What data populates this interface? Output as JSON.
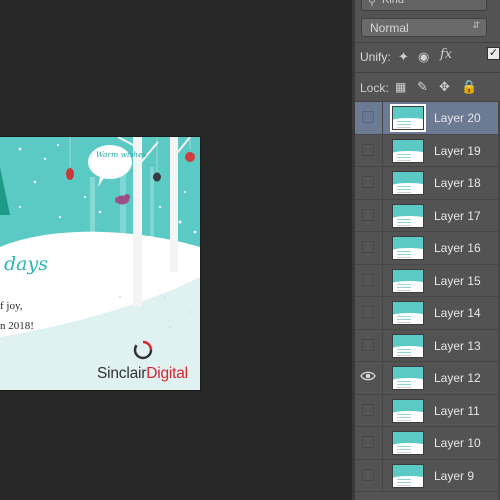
{
  "canvas": {
    "card": {
      "bubble_text": "Warm wishes",
      "title_partial": "days",
      "line1_partial": "f joy,",
      "line2_partial": "n 2018!",
      "brand_part1": "Sinclair",
      "brand_part2": "Digital"
    }
  },
  "layers_panel": {
    "filter_kind": "Kind",
    "blend_mode": "Normal",
    "unify_label": "Unify:",
    "lock_label": "Lock:",
    "layers": [
      {
        "name": "Layer 20",
        "selected": true,
        "visible": false
      },
      {
        "name": "Layer 19",
        "selected": false,
        "visible": false
      },
      {
        "name": "Layer 18",
        "selected": false,
        "visible": false
      },
      {
        "name": "Layer 17",
        "selected": false,
        "visible": false
      },
      {
        "name": "Layer 16",
        "selected": false,
        "visible": false
      },
      {
        "name": "Layer 15",
        "selected": false,
        "visible": false
      },
      {
        "name": "Layer 14",
        "selected": false,
        "visible": false
      },
      {
        "name": "Layer 13",
        "selected": false,
        "visible": false
      },
      {
        "name": "Layer 12",
        "selected": false,
        "visible": true
      },
      {
        "name": "Layer 11",
        "selected": false,
        "visible": false
      },
      {
        "name": "Layer 10",
        "selected": false,
        "visible": false
      },
      {
        "name": "Layer 9",
        "selected": false,
        "visible": false
      }
    ]
  },
  "colors": {
    "teal": "#5bc9c4",
    "selection": "#6c7a94",
    "brand_red": "#d7262e"
  }
}
